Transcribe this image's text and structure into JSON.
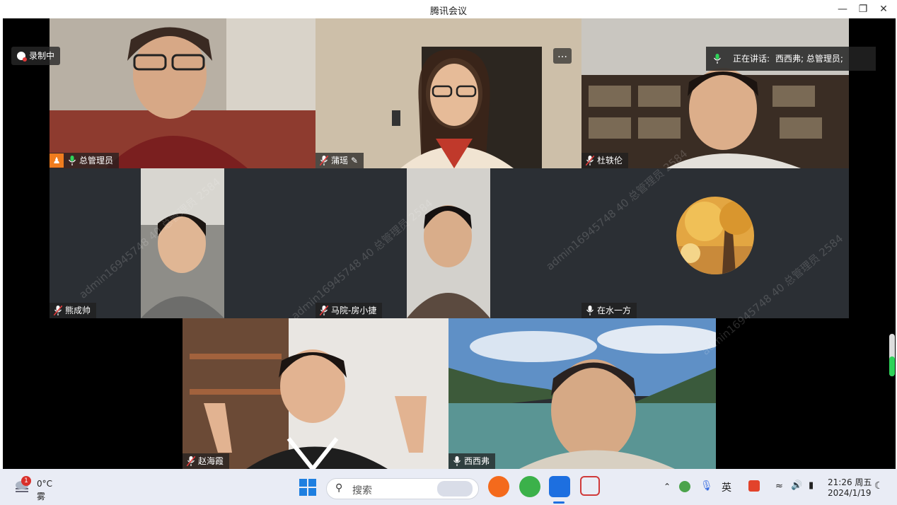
{
  "window": {
    "title": "腾讯会议"
  },
  "recording": {
    "label": "录制中"
  },
  "speaking": {
    "prefix": "正在讲话:",
    "names": "西西弗; 总管理员;"
  },
  "watermark": "admin16945748 40 总管理员 2584",
  "participants": [
    {
      "name": "总管理员",
      "mic": "on",
      "host": true
    },
    {
      "name": "蒲瑶",
      "mic": "muted",
      "editing": true
    },
    {
      "name": "杜轶伦",
      "mic": "muted"
    },
    {
      "name": "熊成帅",
      "mic": "muted"
    },
    {
      "name": "马院-房小捷",
      "mic": "muted"
    },
    {
      "name": "在水一方",
      "mic": "on"
    },
    {
      "name": "赵海霞",
      "mic": "muted"
    },
    {
      "name": "西西弗",
      "mic": "on",
      "speaking": true
    }
  ],
  "taskbar": {
    "weather": {
      "temp": "0°C",
      "condition": "雾",
      "badge": "1"
    },
    "search_placeholder": "搜索",
    "ime": "英",
    "time": "21:26 周五",
    "date": "2024/1/19"
  },
  "colors": {
    "speaking_border": "#2fd35a",
    "tile_bg": "#2b2f34",
    "taskbar_bg": "#e9ecf5"
  }
}
